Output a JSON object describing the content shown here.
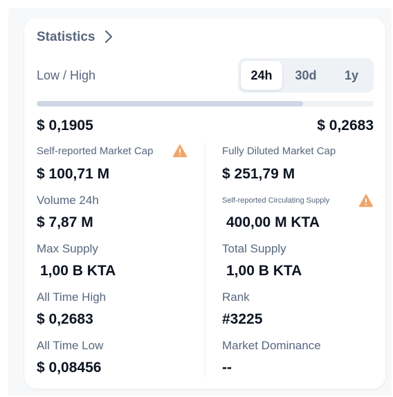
{
  "header": {
    "title": "Statistics",
    "chevron_icon": "chevron-right-icon"
  },
  "range": {
    "label": "Low / High",
    "low": "$ 0,1905",
    "high": "$ 0,2683",
    "fill_fraction": 0.79,
    "periods": [
      {
        "label": "24h",
        "active": true
      },
      {
        "label": "30d",
        "active": false
      },
      {
        "label": "1y",
        "active": false
      }
    ]
  },
  "left": {
    "market_cap_label": "Self-reported Market Cap",
    "market_cap_value": "$ 100,71 M",
    "volume_label": "Volume 24h",
    "volume_value": "$ 7,87 M",
    "max_supply_label": "Max Supply",
    "max_supply_value": "1,00 B KTA",
    "ath_label": "All Time High",
    "ath_value": "$ 0,2683",
    "atl_label": "All Time Low",
    "atl_value": "$ 0,08456"
  },
  "right": {
    "fdmc_label": "Fully Diluted Market Cap",
    "fdmc_value": "$ 251,79 M",
    "circ_supply_label": "Self-reported Circulating Supply",
    "circ_supply_value": "400,00 M KTA",
    "total_supply_label": "Total Supply",
    "total_supply_value": "1,00 B KTA",
    "rank_label": "Rank",
    "rank_value": "#3225",
    "dominance_label": "Market Dominance",
    "dominance_value": "--"
  },
  "colors": {
    "warning": "#f0a56b",
    "text_primary": "#0d1421",
    "text_secondary": "#58667e"
  },
  "icons": {
    "warning": "warning-triangle-icon"
  }
}
